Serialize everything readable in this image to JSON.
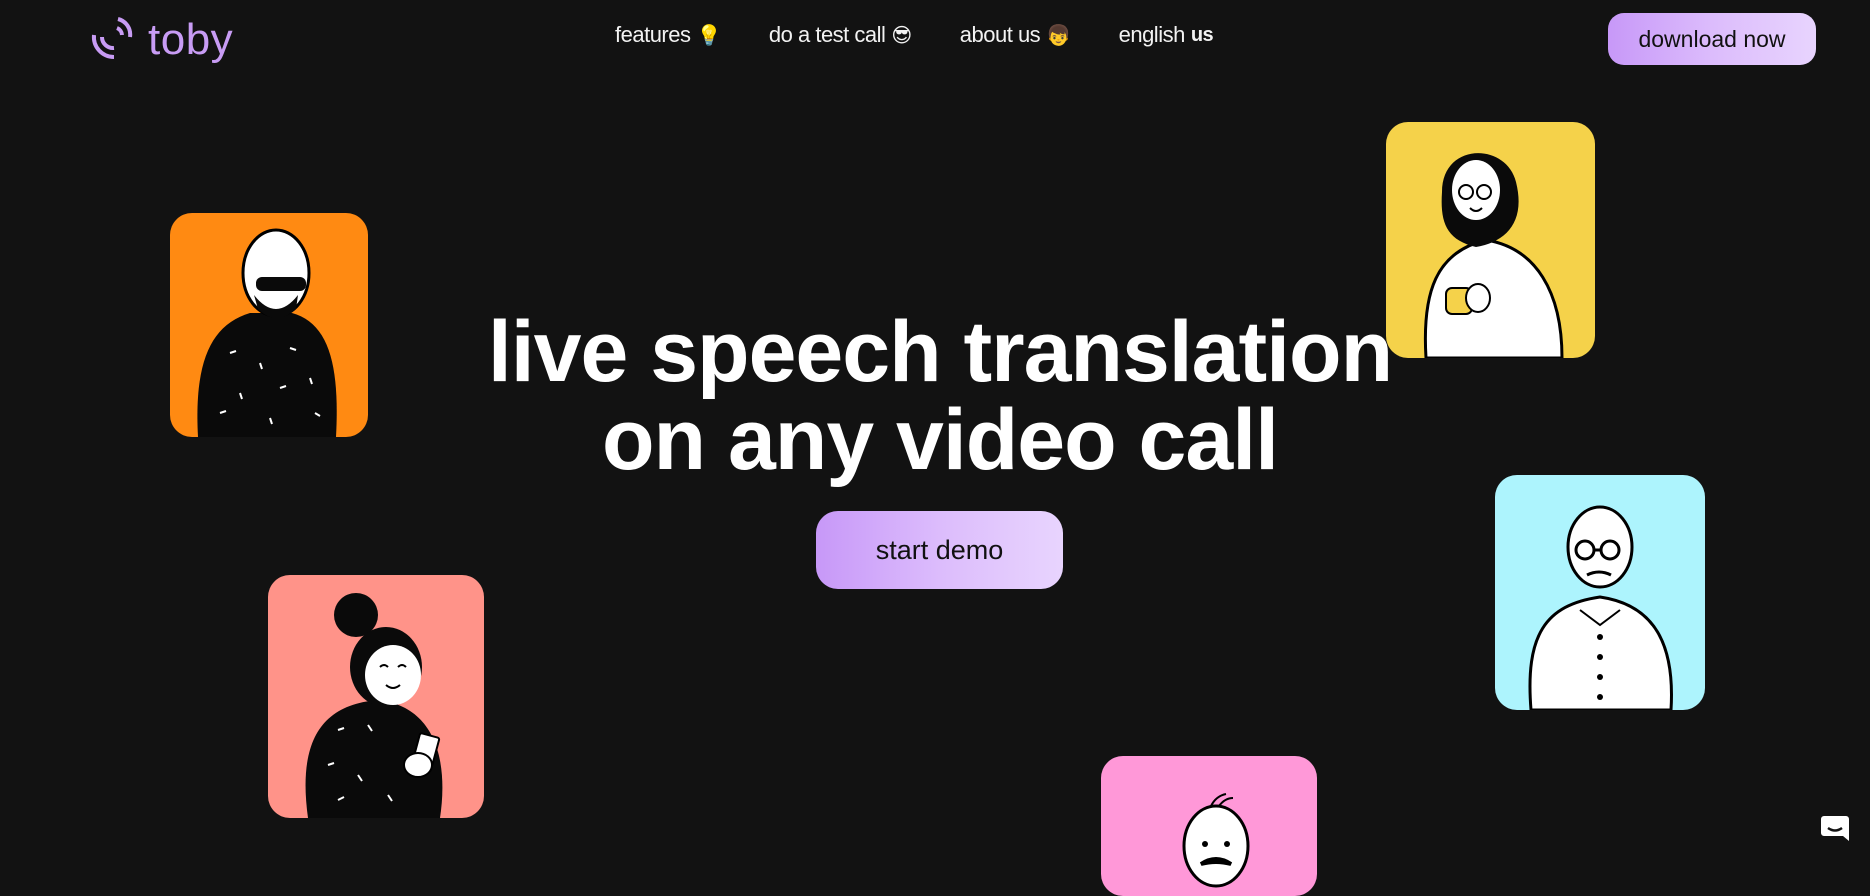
{
  "header": {
    "brand": "toby",
    "logo_icon": "sound-waves-icon",
    "nav": [
      {
        "label": "features",
        "emoji": "💡",
        "icon": "lightbulb-icon"
      },
      {
        "label": "do a test call",
        "emoji": "😎",
        "icon": "sunglasses-face-icon"
      },
      {
        "label": "about us",
        "emoji": "👦",
        "icon": "boy-face-icon"
      },
      {
        "label": "english",
        "suffix": "us",
        "icon": "us-flag-icon"
      }
    ],
    "download_label": "download now"
  },
  "hero": {
    "headline_line1": "live speech translation",
    "headline_line2": "on any video call",
    "cta_label": "start demo"
  },
  "cards": [
    {
      "name": "person-turban-sunglasses",
      "color": "#ff8a12"
    },
    {
      "name": "person-hijab-mug",
      "color": "#f5d24a"
    },
    {
      "name": "person-bun-phone",
      "color": "#ff9389"
    },
    {
      "name": "person-bald-glasses",
      "color": "#adf4fd"
    },
    {
      "name": "person-mustache",
      "color": "#ff98d8"
    }
  ],
  "colors": {
    "background": "#121212",
    "brand": "#c89cf4",
    "button_gradient_start": "#c798f8",
    "button_gradient_end": "#e8d4fe"
  },
  "chat_widget": {
    "icon": "chat-bubble-icon"
  }
}
